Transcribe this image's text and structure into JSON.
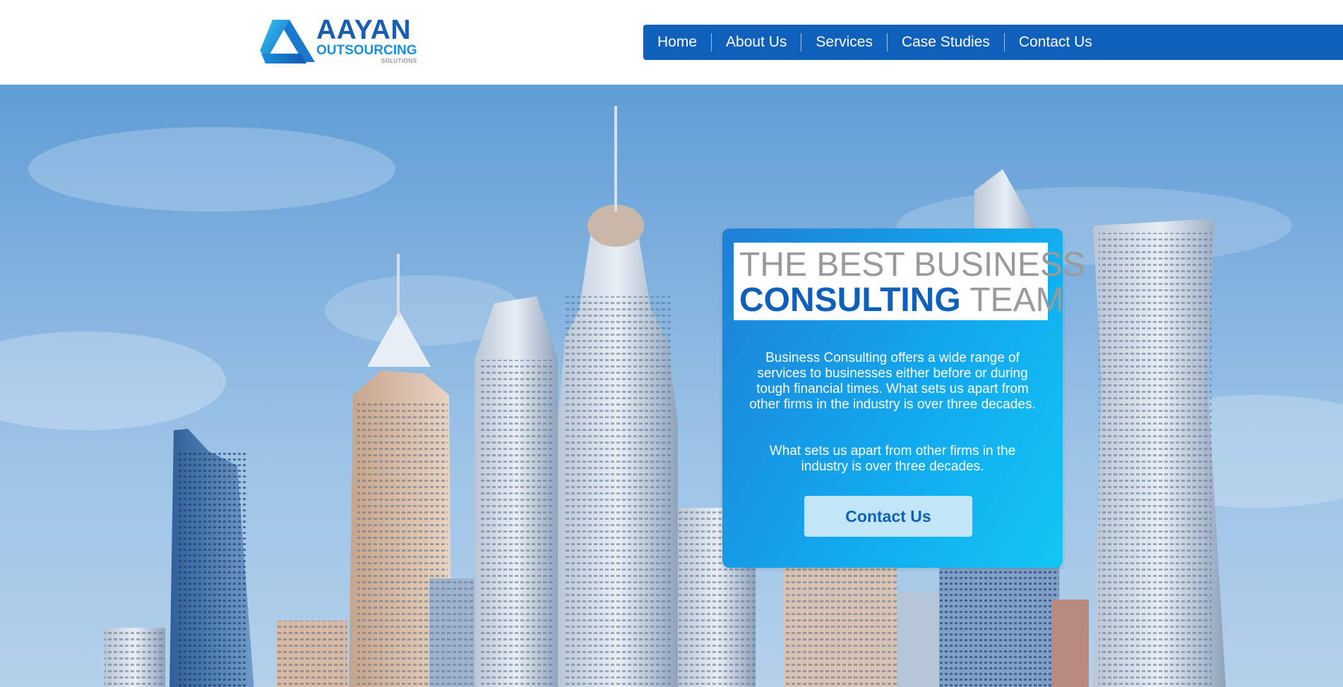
{
  "brand": {
    "name_line1": "AAYAN",
    "name_line2": "OUTSOURCING",
    "name_line3": "SOLUTIONS"
  },
  "nav": {
    "items": [
      {
        "label": "Home"
      },
      {
        "label": "About Us"
      },
      {
        "label": "Services"
      },
      {
        "label": "Case Studies"
      },
      {
        "label": "Contact Us"
      }
    ]
  },
  "hero": {
    "headline_line1": "THE BEST BUSINESS",
    "headline_line2_strong": "CONSULTING",
    "headline_line2_light": " TEAM",
    "paragraph1": "Business Consulting offers a wide range of services to businesses either before or during tough financial times. What sets us apart from other firms in the industry is over three decades.",
    "paragraph2": "What sets us apart from other firms in the industry is over three decades.",
    "cta_label": "Contact Us"
  },
  "colors": {
    "brand_blue": "#0f60ba",
    "accent_cyan": "#12c6f4",
    "cta_bg": "#c3e5f8"
  }
}
